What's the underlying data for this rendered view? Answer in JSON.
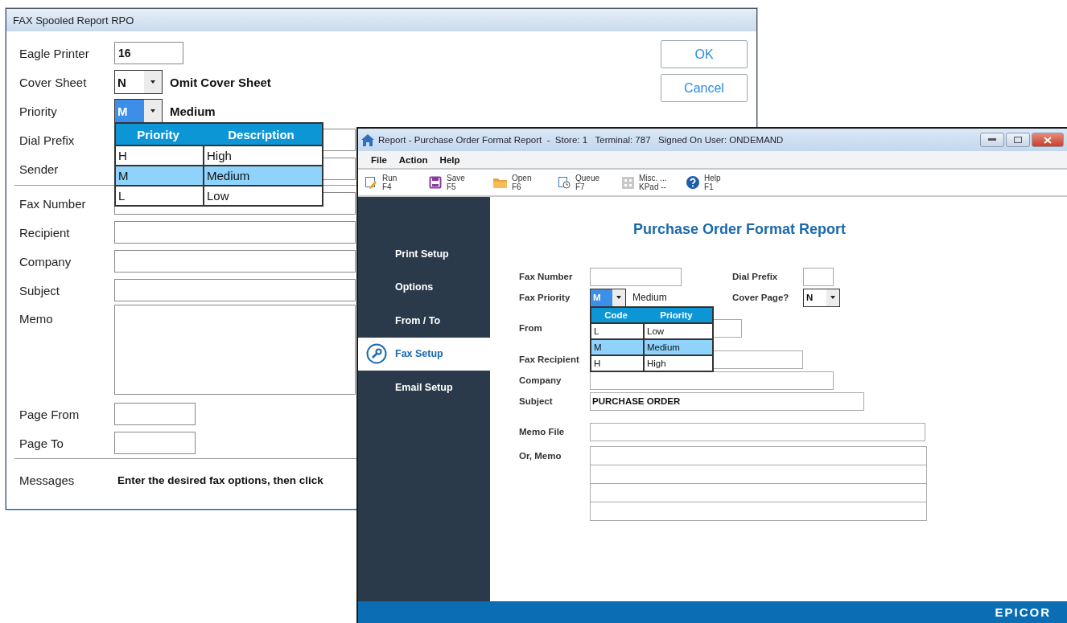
{
  "fax_dialog": {
    "title": "FAX Spooled Report RPO",
    "settings": [
      {
        "label": "Eagle Printer",
        "kind": "input",
        "value": "16"
      },
      {
        "label": "Cover Sheet",
        "kind": "combo",
        "value": "N",
        "description": "Omit Cover Sheet",
        "highlighted": false
      },
      {
        "label": "Priority",
        "kind": "combo",
        "value": "M",
        "description": "Medium",
        "highlighted": true,
        "dropdown": {
          "columns": [
            "Priority",
            "Description"
          ],
          "rows": [
            {
              "code": "H",
              "text": "High",
              "selected": false
            },
            {
              "code": "M",
              "text": "Medium",
              "selected": true
            },
            {
              "code": "L",
              "text": "Low",
              "selected": false
            }
          ]
        }
      },
      {
        "label": "Dial Prefix",
        "kind": "input"
      },
      {
        "label": "Sender",
        "kind": "input"
      }
    ],
    "addressing": [
      {
        "label": "Fax Number",
        "kind": "input"
      },
      {
        "label": "Recipient",
        "kind": "input"
      },
      {
        "label": "Company",
        "kind": "input"
      },
      {
        "label": "Subject",
        "kind": "input"
      },
      {
        "label": "Memo",
        "kind": "memo"
      }
    ],
    "pages": [
      {
        "label": "Page From",
        "kind": "input"
      },
      {
        "label": "Page To",
        "kind": "input"
      }
    ],
    "buttons": [
      "OK",
      "Cancel"
    ],
    "messages": {
      "label": "Messages",
      "text": "Enter the desired fax options, then click"
    }
  },
  "report_window": {
    "title": "Report - Purchase Order Format Report  -  Store: 1   Terminal: 787   Signed On User: ONDEMAND",
    "menu": [
      "File",
      "Action",
      "Help"
    ],
    "toolbar": [
      {
        "kind": "run",
        "label": "Run",
        "key": "F4"
      },
      {
        "kind": "save",
        "label": "Save",
        "key": "F5"
      },
      {
        "kind": "open",
        "label": "Open",
        "key": "F6"
      },
      {
        "kind": "queue",
        "label": "Queue",
        "key": "F7"
      },
      {
        "kind": "keypad",
        "label": "Misc. ...",
        "key": "KPad --"
      },
      {
        "kind": "help",
        "label": "Help",
        "key": "F1"
      }
    ],
    "sidebar": [
      {
        "kind": "plain",
        "label": "Print Setup",
        "selected": false
      },
      {
        "kind": "plain",
        "label": "Options",
        "selected": false
      },
      {
        "kind": "plain",
        "label": "From / To",
        "selected": false
      },
      {
        "kind": "iconic",
        "label": "Fax Setup",
        "selected": true
      },
      {
        "kind": "plain",
        "label": "Email Setup",
        "selected": false
      }
    ],
    "heading": "Purchase Order Format Report",
    "form_rows": [
      [
        {
          "label": "Fax Number",
          "kind": "input"
        },
        {
          "label": "Dial Prefix",
          "kind": "input"
        }
      ],
      [
        {
          "label": "Fax Priority",
          "kind": "combo",
          "value": "M",
          "description": "Medium",
          "highlighted": true,
          "dropdown": {
            "columns": [
              "Code",
              "Priority"
            ],
            "rows": [
              {
                "code": "L",
                "text": "Low",
                "selected": false
              },
              {
                "code": "M",
                "text": "Medium",
                "selected": true
              },
              {
                "code": "H",
                "text": "High",
                "selected": false
              }
            ]
          }
        },
        {
          "label": "Cover Page?",
          "kind": "combo",
          "value": "N",
          "highlighted": false
        }
      ],
      [
        {
          "label": "From",
          "kind": "input"
        }
      ],
      [
        {
          "label": "Fax Recipient",
          "kind": "input"
        }
      ],
      [
        {
          "label": "Company",
          "kind": "input"
        }
      ],
      [
        {
          "label": "Subject",
          "kind": "input",
          "value": "PURCHASE ORDER"
        }
      ],
      [
        {
          "label": "Memo File",
          "kind": "input"
        }
      ],
      [
        {
          "label": "Or, Memo",
          "kind": "memo"
        }
      ]
    ],
    "brand": "EPICOR"
  }
}
